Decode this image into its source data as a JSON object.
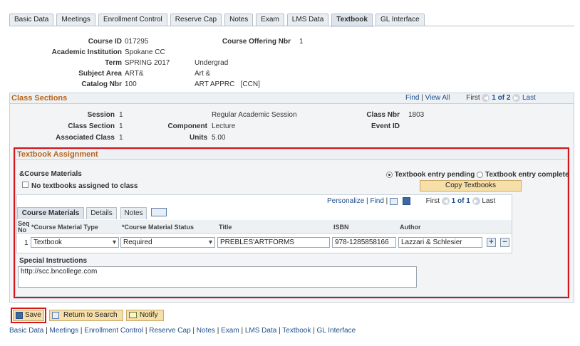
{
  "tabs": [
    {
      "label": "Basic Data"
    },
    {
      "label": "Meetings"
    },
    {
      "label": "Enrollment Control"
    },
    {
      "label": "Reserve Cap"
    },
    {
      "label": "Notes"
    },
    {
      "label": "Exam"
    },
    {
      "label": "LMS Data"
    },
    {
      "label": "Textbook"
    },
    {
      "label": "GL Interface"
    }
  ],
  "header": {
    "course_id_label": "Course ID",
    "course_id": "017295",
    "offering_label": "Course Offering Nbr",
    "offering": "1",
    "institution_label": "Academic Institution",
    "institution": "Spokane CC",
    "term_label": "Term",
    "term": "SPRING 2017",
    "term_desc": "Undergrad",
    "subject_label": "Subject Area",
    "subject": "ART&",
    "subject_desc": "Art &",
    "catalog_label": "Catalog Nbr",
    "catalog": "100",
    "catalog_desc": "ART APPRC   [CCN]"
  },
  "class_sections": {
    "title": "Class Sections",
    "find": "Find",
    "sep": "|",
    "view_all": "View All",
    "first": "First",
    "page": "1 of 2",
    "last": "Last",
    "session_label": "Session",
    "session": "1",
    "session_desc": "Regular Academic Session",
    "class_nbr_label": "Class Nbr",
    "class_nbr": "1803",
    "class_section_label": "Class Section",
    "class_section": "1",
    "component_label": "Component",
    "component": "Lecture",
    "event_id_label": "Event ID",
    "assoc_label": "Associated Class",
    "assoc": "1",
    "units_label": "Units",
    "units": "5.00"
  },
  "textbook": {
    "title": "Textbook Assignment",
    "course_materials_label": "&Course Materials",
    "no_textbooks": "No textbooks assigned to class",
    "entry_pending": "Textbook entry pending",
    "entry_complete": "Textbook entry complete",
    "copy_textbooks": "Copy Textbooks",
    "personalize": "Personalize",
    "find": "Find",
    "first": "First",
    "page": "1 of 1",
    "last": "Last",
    "subtabs": [
      {
        "label": "Course Materials"
      },
      {
        "label": "Details"
      },
      {
        "label": "Notes"
      }
    ],
    "columns": {
      "seq": "Seq No",
      "type": "*Course Material Type",
      "status": "*Course Material Status",
      "title": "Title",
      "isbn": "ISBN",
      "author": "Author"
    },
    "row": {
      "seq": "1",
      "type": "Textbook",
      "status": "Required",
      "title": "PREBLES'ARTFORMS",
      "isbn": "978-1285858166",
      "author": "Lazzari & Schlesier"
    },
    "special_label": "Special Instructions",
    "special_value": "http://scc.bncollege.com"
  },
  "actions": {
    "save": "Save",
    "return": "Return to Search",
    "notify": "Notify"
  },
  "bottom_links": {
    "basic": "Basic Data",
    "meetings": "Meetings",
    "enrollment": "Enrollment Control",
    "reserve": "Reserve Cap",
    "notes": "Notes",
    "exam": "Exam",
    "lms": "LMS Data",
    "textbook": "Textbook",
    "gl": "GL Interface",
    "sep": "|"
  },
  "colors": {
    "highlight_border": "#d4151c",
    "section_title": "#b8651b",
    "link": "#1f4e8c"
  }
}
